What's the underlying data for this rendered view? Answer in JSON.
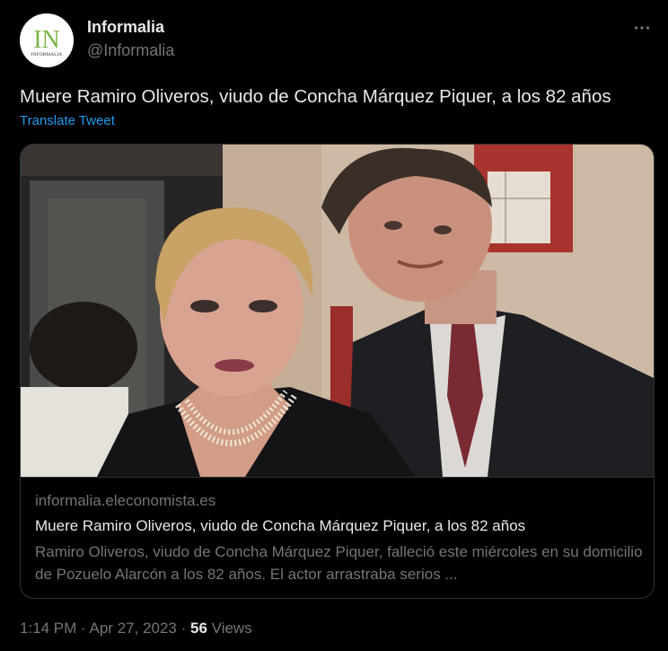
{
  "author": {
    "name": "Informalia",
    "handle": "@Informalia",
    "avatar_icon": "informalia-logo",
    "avatar_letters": "IN",
    "avatar_subtext": "INFORMALIA"
  },
  "more_icon": "more-icon",
  "tweet": {
    "text": "Muere Ramiro Oliveros, viudo de Concha Márquez Piquer, a los 82 años",
    "translate_label": "Translate Tweet"
  },
  "card": {
    "image": "news-photo",
    "domain": "informalia.eleconomista.es",
    "title": "Muere Ramiro Oliveros, viudo de Concha Márquez Piquer, a los 82 años",
    "description": "Ramiro Oliveros, viudo de Concha Márquez Piquer, falleció este miércoles en su domicilio de Pozuelo Alarcón a los 82 años. El actor arrastraba serios ..."
  },
  "meta": {
    "time": "1:14 PM",
    "separator": "·",
    "date": "Apr 27, 2023",
    "views_count": "56",
    "views_label": "Views"
  },
  "colors": {
    "background": "#000000",
    "text_primary": "#e7e9ea",
    "text_secondary": "#71767b",
    "link": "#1d9bf0",
    "border": "#2f3336",
    "logo_green": "#7ab648"
  }
}
